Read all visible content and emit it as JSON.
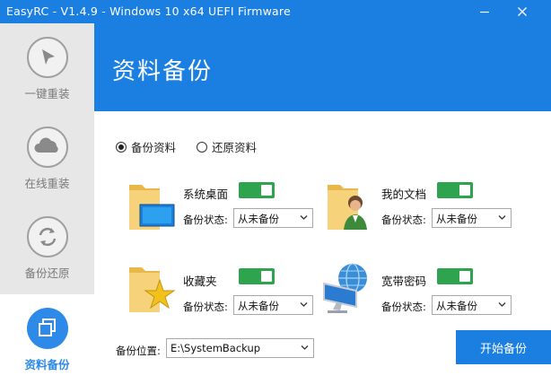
{
  "window": {
    "title": "EasyRC - V1.4.9 - Windows 10 x64 UEFI Firmware",
    "min_glyph": "─",
    "close_glyph": "✕"
  },
  "sidebar": {
    "items": [
      {
        "label": "一键重装",
        "icon": "cursor-arrow-icon",
        "active": false
      },
      {
        "label": "在线重装",
        "icon": "cloud-icon",
        "active": false
      },
      {
        "label": "备份还原",
        "icon": "refresh-arrows-icon",
        "active": false
      },
      {
        "label": "资料备份",
        "icon": "copy-squares-icon",
        "active": true
      }
    ]
  },
  "header": {
    "title": "资料备份"
  },
  "mode": {
    "backup_label": "备份资料",
    "restore_label": "还原资料",
    "selected": "backup"
  },
  "items": [
    {
      "name": "系统桌面",
      "icon": "folder-desktop-icon",
      "toggle_on": true,
      "status_label": "备份状态:",
      "status_value": "从未备份"
    },
    {
      "name": "我的文档",
      "icon": "folder-user-icon",
      "toggle_on": true,
      "status_label": "备份状态:",
      "status_value": "从未备份"
    },
    {
      "name": "收藏夹",
      "icon": "folder-star-icon",
      "toggle_on": true,
      "status_label": "备份状态:",
      "status_value": "从未备份"
    },
    {
      "name": "宽带密码",
      "icon": "globe-monitor-icon",
      "toggle_on": true,
      "status_label": "备份状态:",
      "status_value": "从未备份"
    }
  ],
  "location": {
    "label": "备份位置:",
    "value": "E:\\SystemBackup"
  },
  "start_button": {
    "label": "开始备份"
  },
  "colors": {
    "accent": "#1a7fe0",
    "toggle": "#2ea44f",
    "sidebar_bg": "#e7e7e7",
    "sidebar_text": "#7a7a7a"
  }
}
